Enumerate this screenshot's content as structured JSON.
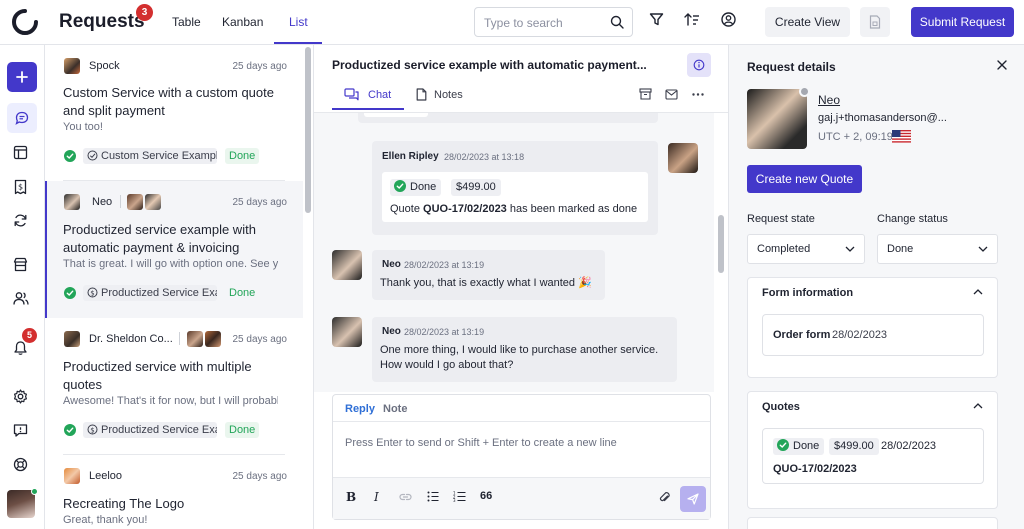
{
  "header": {
    "title": "Requests",
    "badge": "3",
    "tabs": [
      {
        "label": "Table"
      },
      {
        "label": "Kanban"
      },
      {
        "label": "List"
      }
    ],
    "search_placeholder": "Type to search",
    "create_view": "Create View",
    "submit": "Submit Request",
    "accent": "#4338ca"
  },
  "rail": {
    "notifications_badge": "5"
  },
  "list": {
    "items": [
      {
        "name": "Spock",
        "time": "25 days ago",
        "subject": "Custom Service with a custom quote and split payment",
        "preview": "You too!",
        "service": "Custom Service Example",
        "status": "Done"
      },
      {
        "name": "Neo",
        "time": "25 days ago",
        "subject": "Productized service example with automatic payment & invoicing",
        "preview": "That is great. I will go with option one. See you",
        "service": "Productized Service Example",
        "status": "Done"
      },
      {
        "name": "Dr. Sheldon Co...",
        "time": "25 days ago",
        "subject": "Productized service with multiple quotes",
        "preview": "Awesome! That's it for now, but I will probably need more",
        "service": "Productized Service Example",
        "status": "Done"
      },
      {
        "name": "Leeloo",
        "time": "25 days ago",
        "subject": "Recreating The Logo",
        "preview": "Great, thank you!"
      }
    ]
  },
  "conversation": {
    "title": "Productized service example with automatic payment...",
    "tabs": [
      {
        "label": "Chat"
      },
      {
        "label": "Notes"
      }
    ],
    "messages": [
      {
        "name": "Ellen Ripley",
        "time": "28/02/2023 at 13:18",
        "status": "Done",
        "amount": "$499.00",
        "quote_prefix": "Quote ",
        "quote_id": "QUO-17/02/2023",
        "quote_suffix": " has been marked as done"
      },
      {
        "name": "Neo",
        "time": "28/02/2023 at 13:19",
        "text": "Thank you, that is exactly what I wanted 🎉"
      },
      {
        "name": "Neo",
        "time": "28/02/2023 at 13:19",
        "text1": "One more thing, I would like to purchase another service.",
        "text2": "How would I go about that?"
      }
    ],
    "composer": {
      "reply": "Reply",
      "note": "Note",
      "placeholder": "Press Enter to send or Shift + Enter to create a new line",
      "quote_glyph": "66"
    }
  },
  "details": {
    "title": "Request details",
    "client": {
      "name": "Neo",
      "email": "gaj.j+thomasanderson@...",
      "timezone": "UTC + 2, 09:19"
    },
    "create_quote": "Create new Quote",
    "request_state_label": "Request state",
    "request_state_value": "Completed",
    "change_status_label": "Change status",
    "change_status_value": "Done",
    "form_info": {
      "title": "Form information",
      "field_label": "Order form",
      "field_value": "28/02/2023"
    },
    "quotes": {
      "title": "Quotes",
      "status": "Done",
      "amount": "$499.00",
      "date": "28/02/2023",
      "id": "QUO-17/02/2023"
    }
  }
}
